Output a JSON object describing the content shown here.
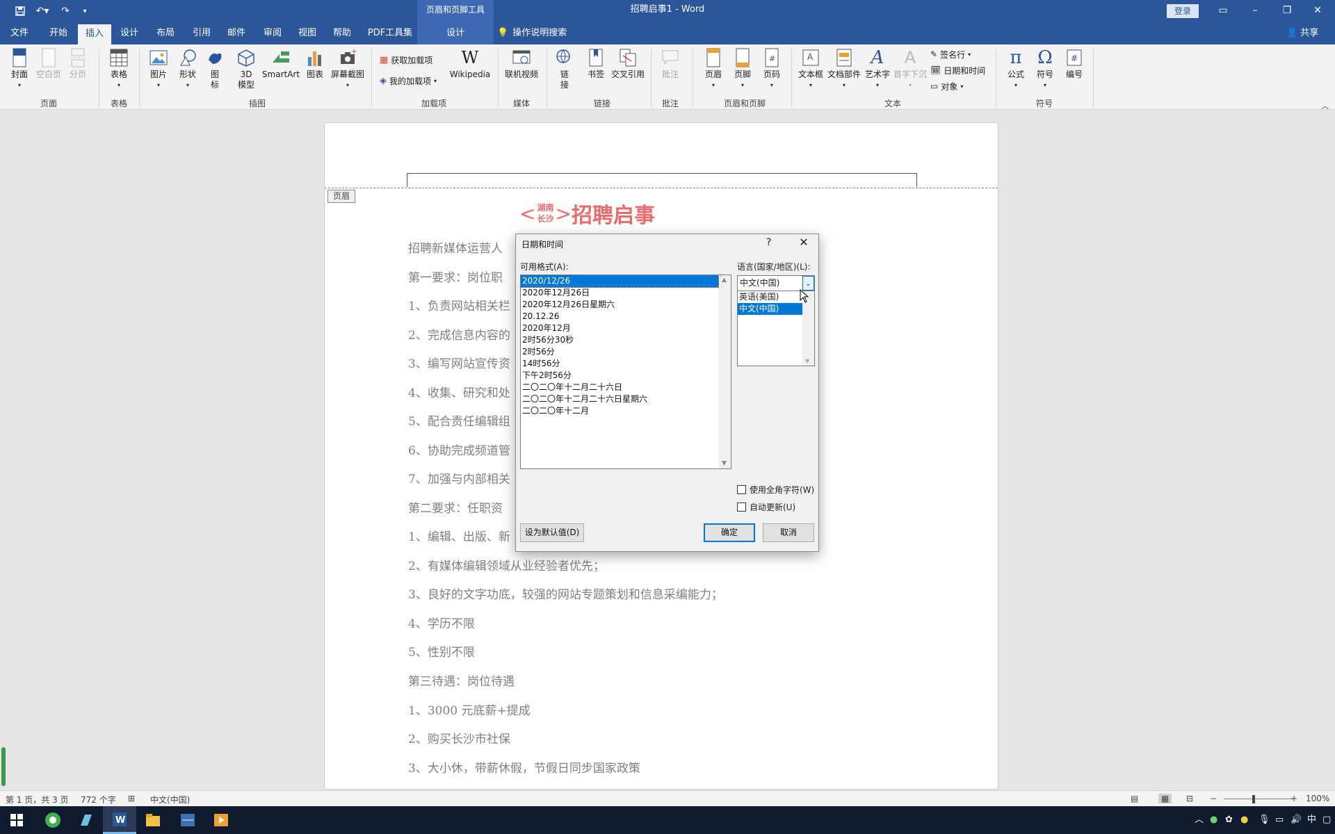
{
  "titlebar": {
    "context_tools": "页眉和页脚工具",
    "title": "招聘启事1  -  Word",
    "login": "登录"
  },
  "tabs": {
    "file": "文件",
    "home": "开始",
    "insert": "插入",
    "design": "设计",
    "layout": "布局",
    "references": "引用",
    "mailings": "邮件",
    "review": "审阅",
    "view": "视图",
    "help": "帮助",
    "pdf": "PDF工具集",
    "hf_design": "设计",
    "tell_me": "操作说明搜索",
    "share": "共享"
  },
  "ribbon": {
    "cover": "封面",
    "blank_page": "空白页",
    "page_break": "分页",
    "table": "表格",
    "picture": "图片",
    "shapes": "形状",
    "icons_1": "图",
    "icons_2": "标",
    "model3d_1": "3D",
    "model3d_2": "模型",
    "smartart": "SmartArt",
    "chart": "图表",
    "screenshot": "屏幕截图",
    "get_addins": "获取加载项",
    "my_addins": "我的加载项",
    "wikipedia": "Wikipedia",
    "online_video": "联机视频",
    "link_1": "链",
    "link_2": "接",
    "bookmark": "书签",
    "cross_ref": "交叉引用",
    "comment": "批注",
    "header": "页眉",
    "footer": "页脚",
    "page_number": "页码",
    "textbox": "文本框",
    "quick_parts": "文档部件",
    "wordart": "艺术字",
    "dropcap": "首字下沉",
    "signature": "签名行",
    "datetime": "日期和时间",
    "object": "对象",
    "equation": "公式",
    "symbol": "符号",
    "number": "编号",
    "groups": {
      "pages": "页面",
      "tables": "表格",
      "illustrations": "插图",
      "addins": "加载项",
      "media": "媒体",
      "links": "链接",
      "comments": "批注",
      "header_footer": "页眉和页脚",
      "text": "文本",
      "symbols": "符号"
    }
  },
  "document": {
    "header_tag": "页眉",
    "headline_prefix_top": "湖南",
    "headline_prefix_bottom": "长沙",
    "headline": "招聘启事",
    "lines": [
      "招聘新媒体运营人",
      "第一要求：岗位职",
      "1、负责网站相关栏",
      "2、完成信息内容的",
      "3、编写网站宣传资",
      "4、收集、研究和处",
      "5、配合责任编辑组",
      "6、协助完成频道管",
      "7、加强与内部相关",
      "第二要求：任职资",
      "1、编辑、出版、新",
      "2、有媒体编辑领域从业经验者优先；",
      "3、良好的文字功底，较强的网站专题策划和信息采编能力；",
      "4、学历不限",
      "5、性别不限",
      "第三待遇：岗位待遇",
      "1、3000 元底薪+提成",
      "2、购买长沙市社保",
      "3、大小休，带薪休假，节假日同步国家政策"
    ]
  },
  "dialog": {
    "title": "日期和时间",
    "help": "?",
    "formats_label": "可用格式(A):",
    "formats": [
      "2020/12/26",
      "2020年12月26日",
      "2020年12月26日星期六",
      "20.12.26",
      "2020年12月",
      "2时56分30秒",
      "2时56分",
      "14时56分",
      "下午2时56分",
      "二〇二〇年十二月二十六日",
      "二〇二〇年十二月二十六日星期六",
      "二〇二〇年十二月"
    ],
    "selected_format_index": 0,
    "language_label": "语言(国家/地区)(L):",
    "language_value": "中文(中国)",
    "language_options": [
      "英语(美国)",
      "中文(中国)"
    ],
    "fullwidth_label": "使用全角字符(W)",
    "autoupdate_label": "自动更新(U)",
    "set_default": "设为默认值(D)",
    "ok": "确定",
    "cancel": "取消"
  },
  "statusbar": {
    "page": "第 1 页，共 3 页",
    "words": "772 个字",
    "language": "中文(中国)",
    "zoom": "100%"
  },
  "taskbar": {
    "ime": "中"
  },
  "colors": {
    "word_blue": "#2b579a",
    "headline_red": "#e96b6b",
    "selection": "#0078d7"
  }
}
